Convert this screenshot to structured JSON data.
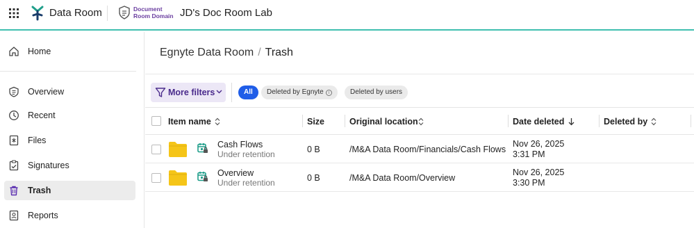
{
  "topbar": {
    "app_name": "Data Room",
    "domain_line1": "Document",
    "domain_line2": "Room Domain",
    "room_title": "JD's Doc Room Lab",
    "accent": "#3fbfb0"
  },
  "sidebar": {
    "items": [
      {
        "label": "Home",
        "icon": "home-icon"
      },
      {
        "label": "Overview",
        "icon": "list-icon"
      },
      {
        "label": "Recent",
        "icon": "clock-icon"
      },
      {
        "label": "Files",
        "icon": "files-icon"
      },
      {
        "label": "Signatures",
        "icon": "signature-icon"
      },
      {
        "label": "Trash",
        "icon": "trash-icon",
        "active": true
      },
      {
        "label": "Reports",
        "icon": "reports-icon"
      }
    ]
  },
  "breadcrumb": {
    "parent": "Egnyte Data Room",
    "separator": "/",
    "current": "Trash"
  },
  "filters": {
    "more_filters": "More filters",
    "chips": [
      "All",
      "Deleted by Egnyte",
      "Deleted by users"
    ],
    "active_chip": "All",
    "info_glyph": "i"
  },
  "table": {
    "columns": [
      "Item name",
      "Size",
      "Original location",
      "Date deleted",
      "Deleted by"
    ],
    "rows": [
      {
        "name": "Cash Flows",
        "status": "Under retention",
        "size": "0 B",
        "location": "/M&A Data Room/Financials/Cash Flows",
        "date": "Nov 26, 2025 3:31 PM",
        "deleted_by": ""
      },
      {
        "name": "Overview",
        "status": "Under retention",
        "size": "0 B",
        "location": "/M&A Data Room/Overview",
        "date": "Nov 26, 2025 3:30 PM",
        "deleted_by": ""
      }
    ]
  },
  "colors": {
    "brand_purple": "#4a2b8c",
    "chip_active": "#1f5de8",
    "folder": "#f5c518",
    "retention": "#1f9e8a"
  }
}
